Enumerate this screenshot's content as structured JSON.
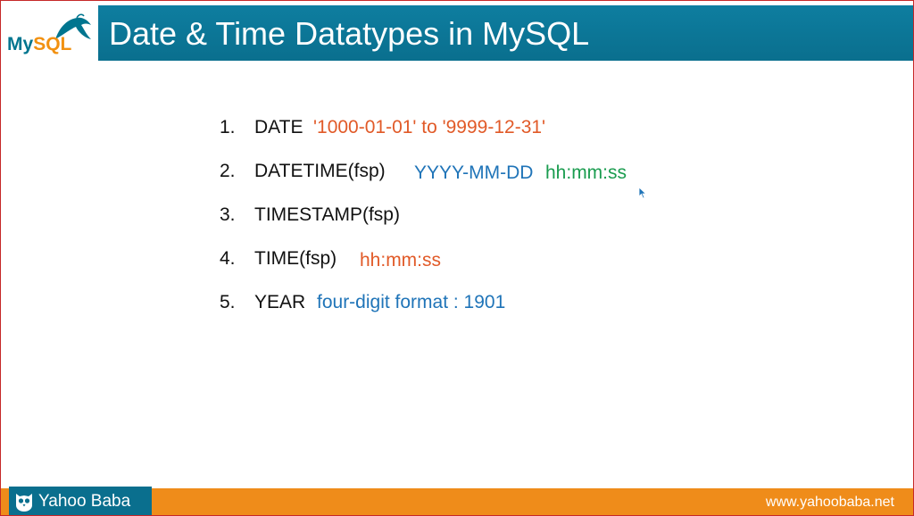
{
  "logo": {
    "my": "My",
    "sql": "SQL"
  },
  "header": {
    "title": "Date & Time Datatypes in MySQL"
  },
  "items": [
    {
      "num": "1.",
      "name": "DATE",
      "notes": [
        {
          "text": "'1000-01-01' to '9999-12-31'",
          "color": "#e15a28"
        }
      ]
    },
    {
      "num": "2.",
      "name": "DATETIME(fsp)",
      "notes": [
        {
          "text": "YYYY-MM-DD",
          "color": "#1f74b8"
        },
        {
          "text": "hh:mm:ss",
          "color": "#1a9c4f"
        }
      ]
    },
    {
      "num": "3.",
      "name": "TIMESTAMP(fsp)",
      "notes": []
    },
    {
      "num": "4.",
      "name": "TIME(fsp)",
      "notes": [
        {
          "text": "hh:mm:ss",
          "color": "#e15a28"
        }
      ]
    },
    {
      "num": "5.",
      "name": "YEAR",
      "notes": [
        {
          "text": "four-digit format : 1901",
          "color": "#1f74b8"
        }
      ]
    }
  ],
  "footer": {
    "brand": "Yahoo Baba",
    "site": "www.yahoobaba.net"
  },
  "colors": {
    "header": "#0a6f8e",
    "footer": "#ef8c1a",
    "orange": "#e15a28",
    "blue": "#1f74b8",
    "green": "#1a9c4f"
  }
}
